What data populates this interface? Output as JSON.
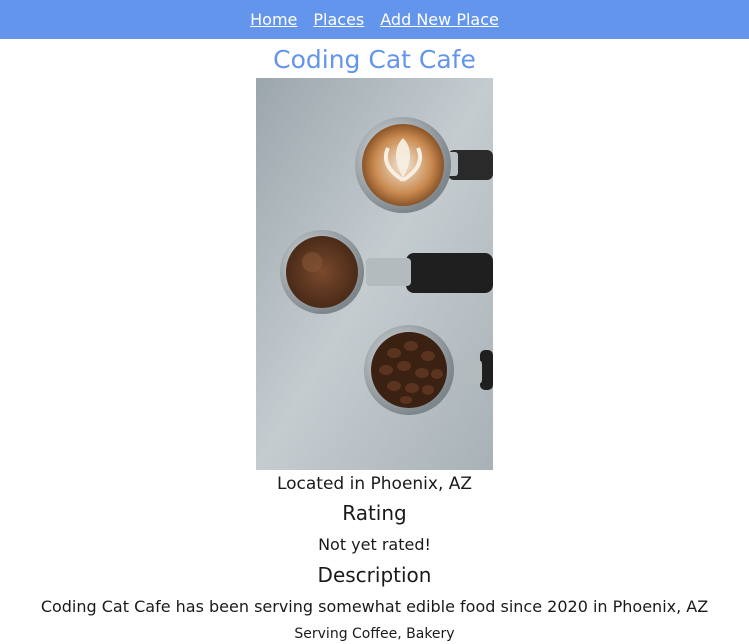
{
  "nav": {
    "links": [
      "Home",
      "Places",
      "Add New Place"
    ]
  },
  "place": {
    "name": "Coding Cat Cafe",
    "image_alt": "coffee",
    "location": "Located in Phoenix, AZ",
    "rating_heading": "Rating",
    "rating_text": "Not yet rated!",
    "description_heading": "Description",
    "description": "Coding Cat Cafe has been serving somewhat edible food since 2020 in Phoenix, AZ",
    "serving": "Serving Coffee, Bakery"
  },
  "colors": {
    "nav_background": "#6495ed",
    "title": "#6495ed"
  }
}
